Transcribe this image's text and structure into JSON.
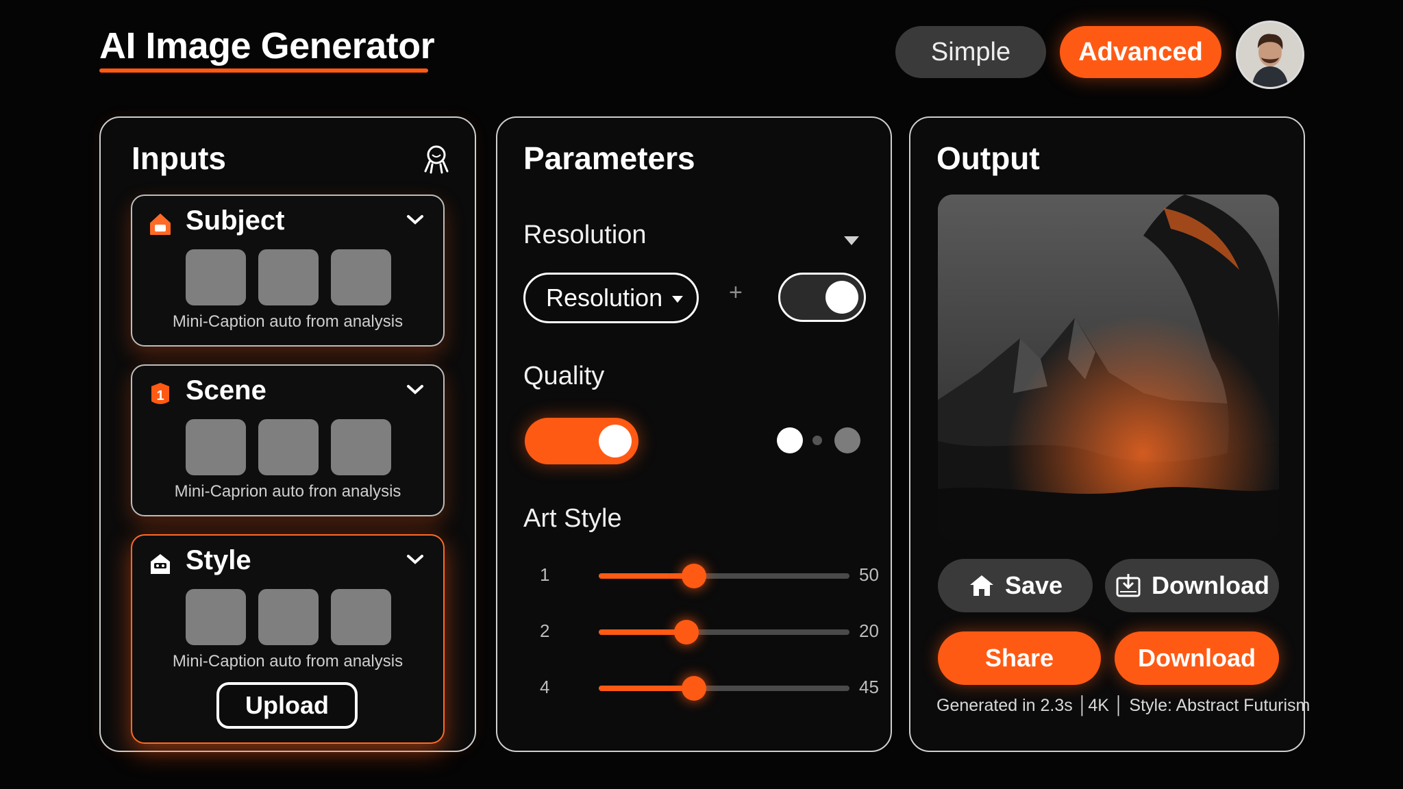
{
  "app": {
    "title": "AI Image Generator"
  },
  "header": {
    "mode_simple": "Simple",
    "mode_advanced": "Advanced",
    "accent_color": "#ff5a14"
  },
  "inputs": {
    "title": "Inputs",
    "cards": [
      {
        "label": "Subject",
        "icon": "lock-icon",
        "caption": "Mini-Caption auto from analysis"
      },
      {
        "label": "Scene",
        "icon": "badge-1-icon",
        "caption": "Mini-Caprion auto fron analysis"
      },
      {
        "label": "Style",
        "icon": "robot-icon",
        "caption": "Mini-Caption auto from analysis",
        "upload_label": "Upload"
      }
    ]
  },
  "parameters": {
    "title": "Parameters",
    "resolution_label": "Resolution",
    "resolution_select": "Resolution",
    "plus": "+",
    "quality_label": "Quality",
    "art_style_label": "Art Style",
    "sliders": [
      {
        "index": "1",
        "value": "50",
        "fill": 0.38
      },
      {
        "index": "2",
        "value": "20",
        "fill": 0.35
      },
      {
        "index": "4",
        "value": "45",
        "fill": 0.38
      }
    ]
  },
  "output": {
    "title": "Output",
    "save_label": "Save",
    "download_secondary_label": "Download",
    "share_label": "Share",
    "download_label": "Download",
    "meta": "Generated in 2.3s │4K │ Style: Abstract Futurism"
  }
}
